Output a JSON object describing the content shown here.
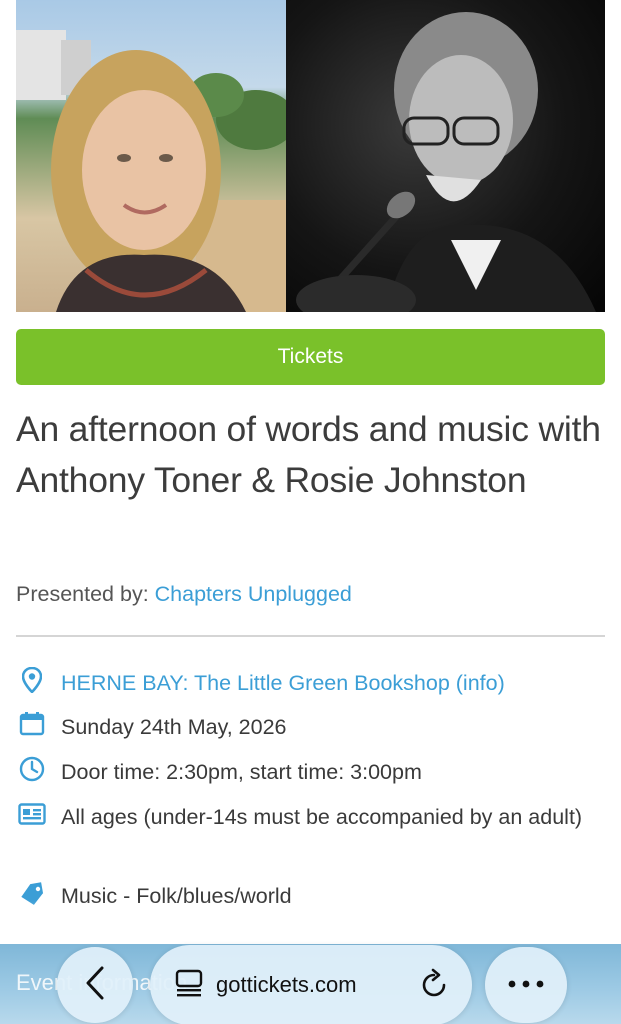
{
  "hero": {
    "left_photo": "photo-rosie-johnston",
    "right_photo": "photo-anthony-toner-with-guitar-and-microphone"
  },
  "tickets_button": {
    "label": "Tickets",
    "color": "#7ac12a"
  },
  "event": {
    "title": "An afternoon of words and music with Anthony Toner & Rosie Johnston",
    "presented_label": "Presented by:",
    "presenter": "Chapters Unplugged"
  },
  "details": [
    {
      "icon": "location-pin-icon",
      "text": "HERNE BAY: The Little Green Bookshop (info)"
    },
    {
      "icon": "calendar-icon",
      "text": "Sunday 24th May, 2026"
    },
    {
      "icon": "clock-icon",
      "text": "Door time: 2:30pm, start time: 3:00pm"
    },
    {
      "icon": "id-card-icon",
      "text": "All ages (under-14s must be accompanied by an adult)"
    },
    {
      "icon": "tag-icon",
      "text": "Music - Folk/blues/world"
    }
  ],
  "bottom_strip": {
    "text": "Event information"
  },
  "browser": {
    "url": "gottickets.com",
    "accent": "#3b9ed6"
  }
}
